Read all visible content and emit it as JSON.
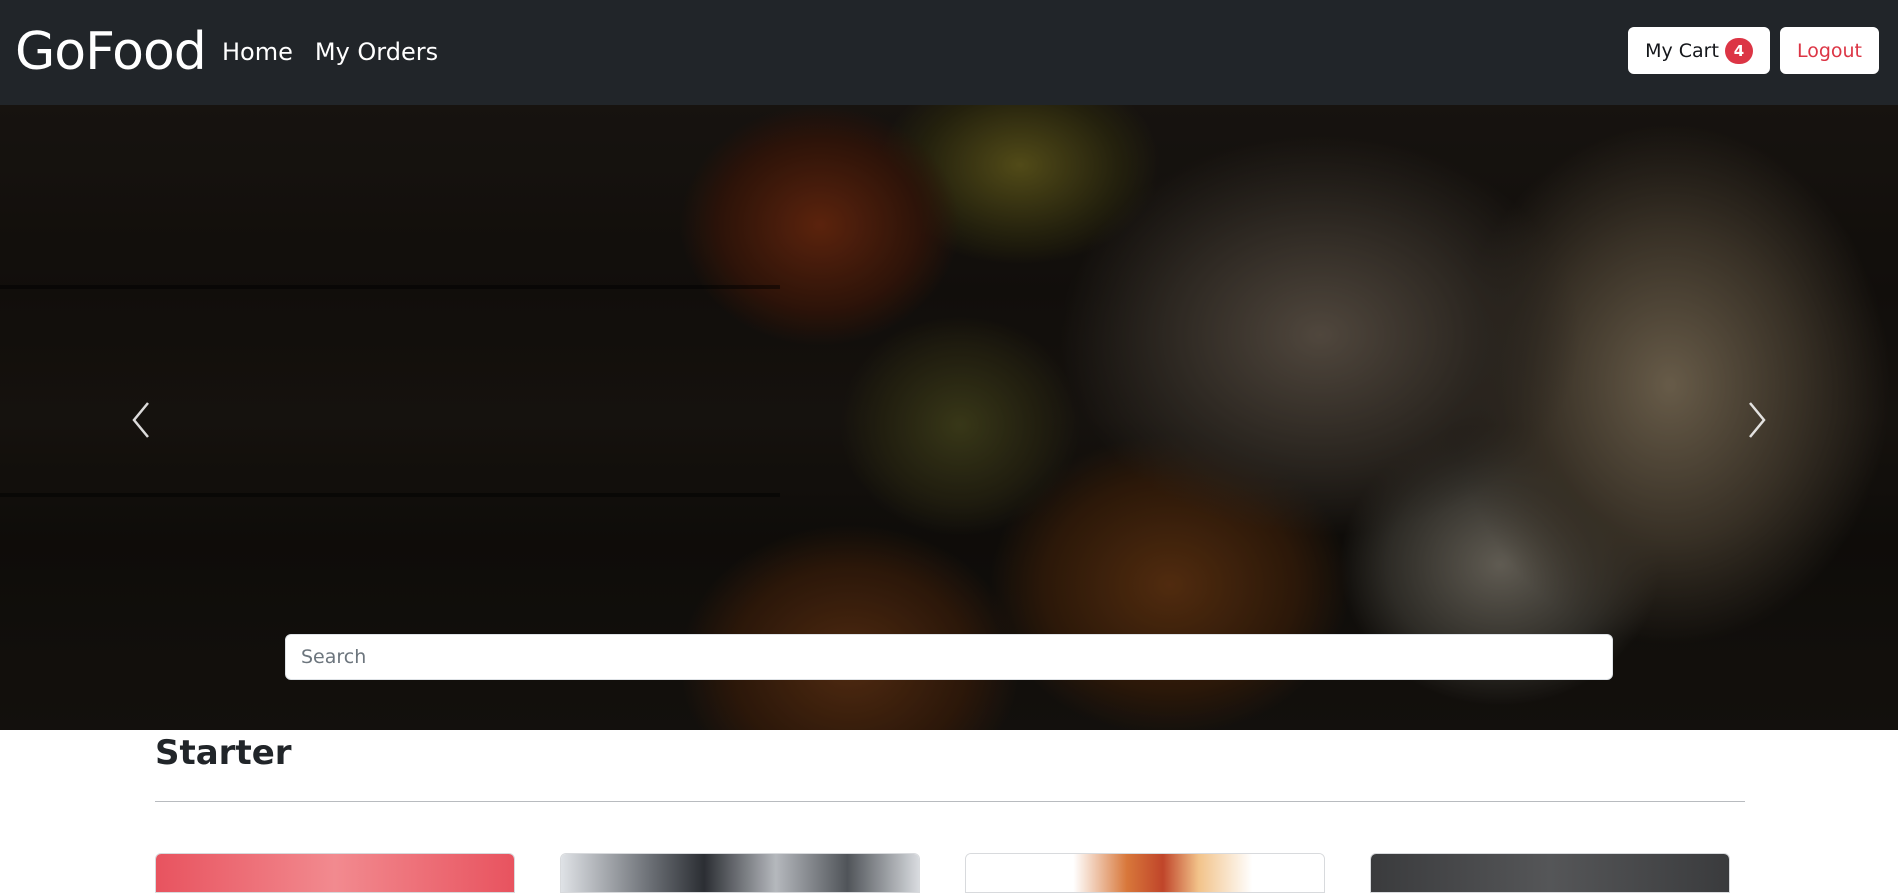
{
  "navbar": {
    "brand": "GoFood",
    "links": [
      "Home",
      "My Orders"
    ],
    "cart_label": "My Cart",
    "cart_count": "4",
    "logout_label": "Logout"
  },
  "hero": {
    "search_placeholder": "Search"
  },
  "category": {
    "title": "Starter"
  },
  "colors": {
    "navbar_bg": "#212529",
    "badge_bg": "#dc3545",
    "logout_text": "#dc3545"
  }
}
